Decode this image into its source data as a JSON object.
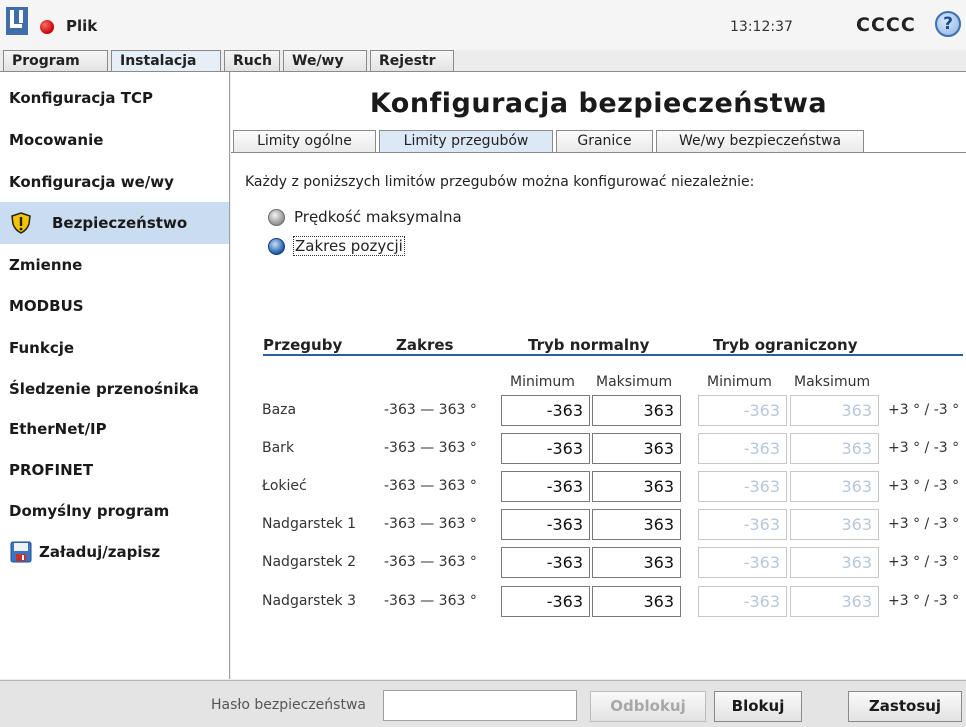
{
  "header": {
    "app_title": "Plik",
    "clock": "13:12:37",
    "robot_name": "CCCC",
    "help_glyph": "?",
    "logo_icon": "ur-logo-icon",
    "status_icon": "status-dot-icon"
  },
  "main_tabs": [
    {
      "label": "Program",
      "active": false
    },
    {
      "label": "Instalacja",
      "active": true
    },
    {
      "label": "Ruch",
      "active": false
    },
    {
      "label": "We/wy",
      "active": false
    },
    {
      "label": "Rejestr",
      "active": false
    }
  ],
  "sidebar": {
    "items": [
      {
        "label": "Konfiguracja TCP"
      },
      {
        "label": "Mocowanie"
      },
      {
        "label": "Konfiguracja we/wy"
      },
      {
        "label": "Bezpieczeństwo",
        "icon": "warning-shield-icon",
        "active": true
      },
      {
        "label": "Zmienne"
      },
      {
        "label": "MODBUS"
      },
      {
        "label": "Funkcje"
      },
      {
        "label": "Śledzenie przenośnika"
      },
      {
        "label": "EtherNet/IP"
      },
      {
        "label": "PROFINET"
      },
      {
        "label": "Domyślny program"
      },
      {
        "label": "Załaduj/zapisz",
        "icon": "floppy-disk-icon"
      }
    ]
  },
  "page": {
    "title": "Konfiguracja bezpieczeństwa",
    "sub_tabs": [
      {
        "label": "Limity ogólne",
        "active": false
      },
      {
        "label": "Limity przegubów",
        "active": true
      },
      {
        "label": "Granice",
        "active": false
      },
      {
        "label": "We/wy bezpieczeństwa",
        "active": false
      }
    ],
    "description": "Każdy z poniższych limitów przegubów można konfigurować niezależnie:",
    "radios": [
      {
        "label": "Prędkość maksymalna",
        "selected": false
      },
      {
        "label": "Zakres pozycji",
        "selected": true
      }
    ]
  },
  "table": {
    "headers": {
      "joints": "Przeguby",
      "range": "Zakres",
      "normal": "Tryb normalny",
      "reduced": "Tryb ograniczony"
    },
    "sub_headers": {
      "min": "Minimum",
      "max": "Maksimum"
    },
    "rows": [
      {
        "name": "Baza",
        "range": "-363 — 363 °",
        "normal_min": "-363",
        "normal_max": "363",
        "reduced_min": "-363",
        "reduced_max": "363",
        "tolerance": "+3 ° / -3 °"
      },
      {
        "name": "Bark",
        "range": "-363 — 363 °",
        "normal_min": "-363",
        "normal_max": "363",
        "reduced_min": "-363",
        "reduced_max": "363",
        "tolerance": "+3 ° / -3 °"
      },
      {
        "name": "Łokieć",
        "range": "-363 — 363 °",
        "normal_min": "-363",
        "normal_max": "363",
        "reduced_min": "-363",
        "reduced_max": "363",
        "tolerance": "+3 ° / -3 °"
      },
      {
        "name": "Nadgarstek 1",
        "range": "-363 — 363 °",
        "normal_min": "-363",
        "normal_max": "363",
        "reduced_min": "-363",
        "reduced_max": "363",
        "tolerance": "+3 ° / -3 °"
      },
      {
        "name": "Nadgarstek 2",
        "range": "-363 — 363 °",
        "normal_min": "-363",
        "normal_max": "363",
        "reduced_min": "-363",
        "reduced_max": "363",
        "tolerance": "+3 ° / -3 °"
      },
      {
        "name": "Nadgarstek 3",
        "range": "-363 — 363 °",
        "normal_min": "-363",
        "normal_max": "363",
        "reduced_min": "-363",
        "reduced_max": "363",
        "tolerance": "+3 ° / -3 °"
      }
    ]
  },
  "footer": {
    "password_label": "Hasło bezpieczeństwa",
    "password_value": "",
    "unlock_label": "Odblokuj",
    "lock_label": "Blokuj",
    "apply_label": "Zastosuj"
  },
  "colors": {
    "accent": "#2c5d9c",
    "active_sidebar": "#c9dcf0",
    "status_red": "#c40000"
  }
}
